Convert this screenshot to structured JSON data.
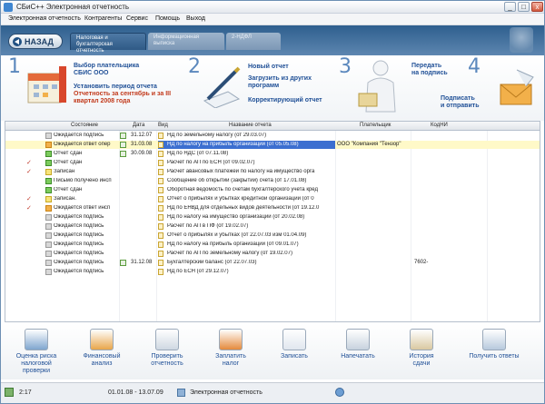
{
  "window": {
    "title": "СБиС++ Электронная отчетность"
  },
  "window_controls": [
    "_",
    "□",
    "x"
  ],
  "menu": [
    "Электронная отчетность",
    "Контрагенты",
    "Сервис",
    "Помощь",
    "Выход"
  ],
  "header": {
    "back_label": "НАЗАД",
    "tabs": [
      {
        "line1": "Налоговая и",
        "line2": "бухгалтерская отчетность"
      },
      {
        "line1": "Информационная",
        "line2": "выписка"
      },
      {
        "line1": "2-НДФЛ",
        "line2": ""
      }
    ]
  },
  "steps": {
    "numbers": [
      "1",
      "2",
      "3",
      "4"
    ],
    "step1": {
      "link1_l1": "Выбор плательщика",
      "link1_l2": "СБИС ООО",
      "link2_l1": "Установить период отчета",
      "link2_l2": "Отчетность за сентябрь и за III",
      "link2_l3": "квартал 2008 года"
    },
    "step2": {
      "new_report": "Новый отчет",
      "load_l1": "Загрузить из других",
      "load_l2": "программ",
      "correct": "Корректирующий отчет"
    },
    "step3": {
      "sign_l1": "Передать",
      "sign_l2": "на подпись"
    },
    "step4": {
      "send_l1": "Подписать",
      "send_l2": "и отправить"
    }
  },
  "table": {
    "columns": {
      "status": "Состояние",
      "date": "Дата",
      "view": "Вид",
      "name": "Название отчета",
      "payer": "Плательщик",
      "kdni": "КодНИ"
    },
    "rows": [
      {
        "mark": "",
        "status": "Ожидается подпись",
        "date": "31.12.07",
        "name": "НД по земельному налогу (от 29.03.07)",
        "payer": "",
        "kdni": "",
        "icon": "gray"
      },
      {
        "mark": "",
        "status": "Ожидается ответ опер",
        "date": "31.03.08",
        "name": "НД по налогу на прибыль организаций (от 05.05.08)",
        "payer": "ООО \"Компания \"Тензор\"",
        "kdni": "",
        "icon": "orange",
        "selected": true
      },
      {
        "mark": "",
        "status": "Отчет сдан",
        "date": "30.09.08",
        "name": "НД по НДС (от 07.11.08)",
        "payer": "",
        "kdni": "",
        "icon": "green"
      },
      {
        "mark": "✓",
        "status": "Отчет сдан",
        "date": "",
        "name": "Расчет по АП по ЕСН (от 09.02.07)",
        "payer": "",
        "kdni": "",
        "icon": "green"
      },
      {
        "mark": "✓",
        "status": "Записан",
        "date": "",
        "name": "Расчет авансовых платежей по налогу на имущество орга",
        "payer": "",
        "kdni": "",
        "icon": "yellow"
      },
      {
        "mark": "",
        "status": "Письмо получено инсп",
        "date": "",
        "name": "Сообщение об открытии (закрытии) счета (от 17.01.08)",
        "payer": "",
        "kdni": "",
        "icon": "green"
      },
      {
        "mark": "",
        "status": "Отчет сдан",
        "date": "",
        "name": "Оборотная ведомость по счетам бухгалтерского учета кред",
        "payer": "",
        "kdni": "",
        "icon": "green"
      },
      {
        "mark": "✓",
        "status": "Записан.",
        "date": "",
        "name": "Отчет о прибылях и убытках кредитной организации (от 0",
        "payer": "",
        "kdni": "",
        "icon": "yellow"
      },
      {
        "mark": "✓",
        "status": "Ожидается ответ инсп",
        "date": "",
        "name": "НД по ЕНВД для отдельных видов деятельности (от 19.12.0",
        "payer": "",
        "kdni": "",
        "icon": "orange"
      },
      {
        "mark": "",
        "status": "Ожидается подпись",
        "date": "",
        "name": "НД по налогу на имущество организаций (от 20.02.08)",
        "payer": "",
        "kdni": "",
        "icon": "gray"
      },
      {
        "mark": "",
        "status": "Ожидается подпись",
        "date": "",
        "name": "Расчет по АП в ПФ (от 19.02.07)",
        "payer": "",
        "kdni": "",
        "icon": "gray"
      },
      {
        "mark": "",
        "status": "Ожидается подпись",
        "date": "",
        "name": "Отчет о прибылях и убытках (от 22.07.03 изм 01.04.09)",
        "payer": "",
        "kdni": "",
        "icon": "gray"
      },
      {
        "mark": "",
        "status": "Ожидается подпись",
        "date": "",
        "name": "НД по налогу на прибыль организаций (от 09.01.07)",
        "payer": "",
        "kdni": "",
        "icon": "gray"
      },
      {
        "mark": "",
        "status": "Ожидается подпись",
        "date": "",
        "name": "Расчет по АП по земельному налогу (от 19.02.07)",
        "payer": "",
        "kdni": "",
        "icon": "gray"
      },
      {
        "mark": "",
        "status": "Ожидается подпись",
        "date": "31.12.08",
        "name": "Бухгалтерский баланс (от 22.07.03)",
        "payer": "",
        "kdni": "7602-",
        "icon": "gray"
      },
      {
        "mark": "",
        "status": "Ожидается подпись",
        "date": "",
        "name": "НД по ЕСН (от 29.12.07)",
        "payer": "",
        "kdni": "",
        "icon": "gray"
      }
    ]
  },
  "toolbar": [
    {
      "l1": "Оценка риска",
      "l2": "налоговой проверки",
      "color": "#7fa6cf"
    },
    {
      "l1": "Финансовый",
      "l2": "анализ",
      "color": "#e9a64a"
    },
    {
      "l1": "Проверить",
      "l2": "отчетность",
      "color": "#cfd8e2"
    },
    {
      "l1": "Заплатить",
      "l2": "налог",
      "color": "#e48a3c"
    },
    {
      "l1": "Записать",
      "l2": "",
      "color": "#e0e6ee"
    },
    {
      "l1": "Напечатать",
      "l2": "",
      "color": "#c7d2de"
    },
    {
      "l1": "История",
      "l2": "сдачи",
      "color": "#d9c8a1"
    },
    {
      "l1": "Получить ответы",
      "l2": "",
      "color": "#b7c9dd"
    }
  ],
  "statusbar": {
    "time": "2:17",
    "period": "01.01.08 - 13.07.09",
    "module": "Электронная отчетность"
  }
}
